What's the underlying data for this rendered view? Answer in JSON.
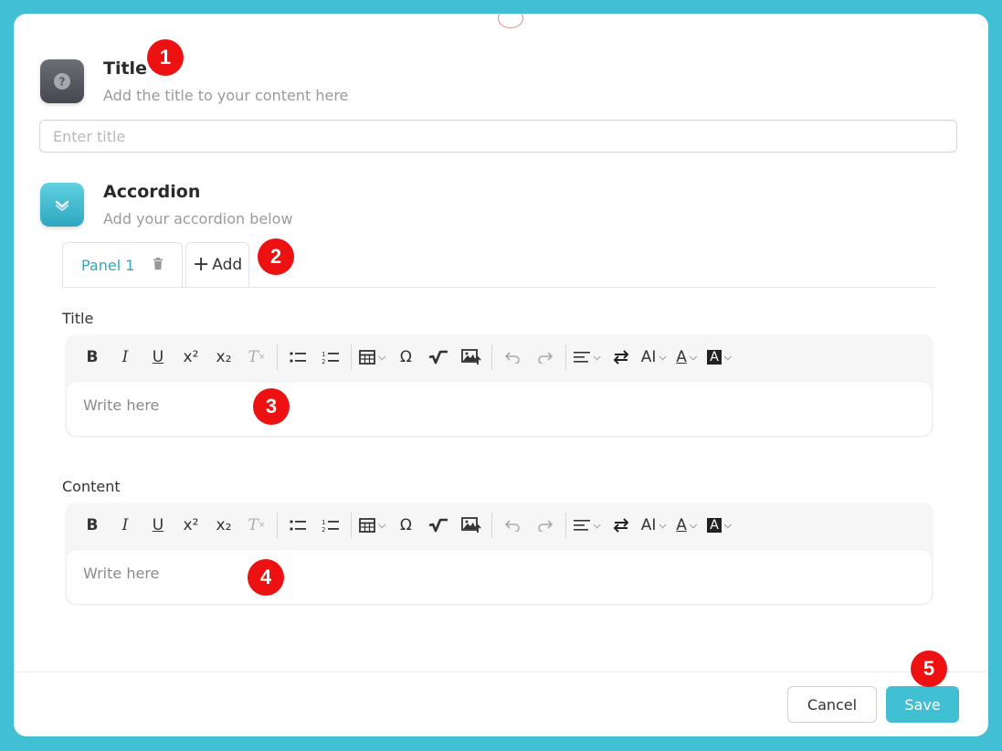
{
  "sections": {
    "title": {
      "heading": "Title",
      "subtitle": "Add the title to your content here",
      "input_placeholder": "Enter title"
    },
    "accordion": {
      "heading": "Accordion",
      "subtitle": "Add your accordion below"
    }
  },
  "tabs": {
    "panel1_label": "Panel 1",
    "add_label": "Add"
  },
  "fields": {
    "title_label": "Title",
    "title_placeholder": "Write here",
    "content_label": "Content",
    "content_placeholder": "Write here"
  },
  "toolbar": {
    "bold": "B",
    "italic": "I",
    "underline": "U",
    "superscript": "x²",
    "subscript": "x₂",
    "clear_format": "T",
    "omega": "Ω",
    "font_size": "AI",
    "font_color": "A",
    "bg_color": "A"
  },
  "markers": [
    "1",
    "2",
    "3",
    "4",
    "5"
  ],
  "footer": {
    "cancel_label": "Cancel",
    "save_label": "Save"
  },
  "colors": {
    "accent": "#41bfd3",
    "marker": "#ee1111",
    "tab_active": "#2aa8c3"
  }
}
